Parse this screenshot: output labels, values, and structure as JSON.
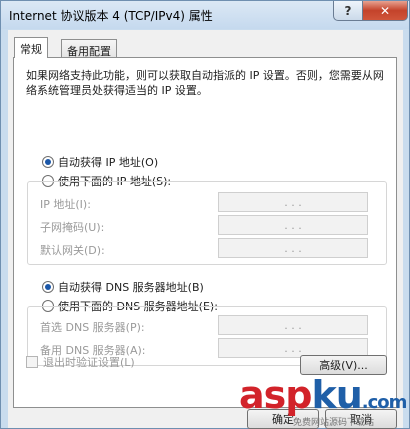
{
  "window": {
    "title": "Internet 协议版本 4 (TCP/IPv4) 属性",
    "help_label": "?",
    "close_label": "✕"
  },
  "tabs": [
    {
      "label": "常规",
      "selected": true
    },
    {
      "label": "备用配置",
      "selected": false
    }
  ],
  "intro": "如果网络支持此功能，则可以获取自动指派的 IP 设置。否则，您需要从网络系统管理员处获得适当的 IP 设置。",
  "ip": {
    "auto_label": "自动获得 IP 地址(O)",
    "manual_label": "使用下面的 IP 地址(S):",
    "selected": "auto",
    "fields": [
      {
        "label": "IP 地址(I):",
        "value": ". . ."
      },
      {
        "label": "子网掩码(U):",
        "value": ". . ."
      },
      {
        "label": "默认网关(D):",
        "value": ". . ."
      }
    ]
  },
  "dns": {
    "auto_label": "自动获得 DNS 服务器地址(B)",
    "manual_label": "使用下面的 DNS 服务器地址(E):",
    "selected": "auto",
    "fields": [
      {
        "label": "首选 DNS 服务器(P):",
        "value": ". . ."
      },
      {
        "label": "备用 DNS 服务器(A):",
        "value": ". . ."
      }
    ]
  },
  "validate_label": "退出时验证设置(L)",
  "advanced_label": "高级(V)...",
  "ok_label": "确定",
  "cancel_label": "取消",
  "watermark": {
    "part1": "asp",
    "part2": "ku",
    "suffix": ".com",
    "tagline": "免费网站源码下载站"
  },
  "colors": {
    "accent": "#1b57a8",
    "disabled_text": "#9a9a9a",
    "close_red": "#c4432b"
  }
}
